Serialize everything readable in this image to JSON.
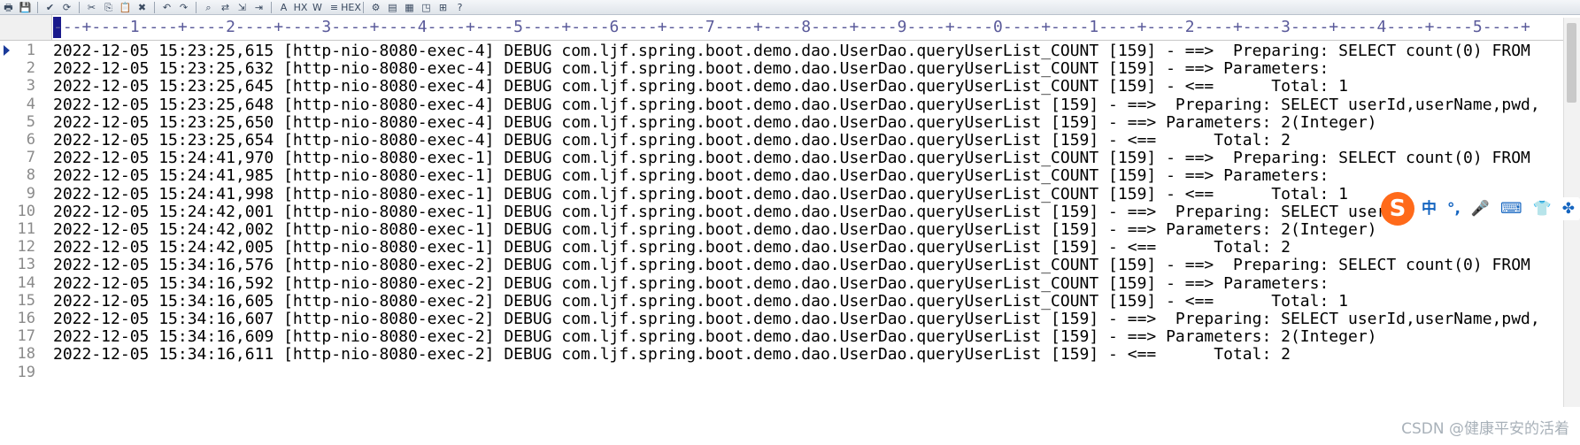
{
  "toolbar": {
    "icons": [
      "print-icon",
      "save-icon",
      "check-icon",
      "refresh-icon",
      "cut-icon",
      "copy-icon",
      "paste-icon",
      "delete-icon",
      "undo-icon",
      "redo-icon",
      "find-icon",
      "replace-icon",
      "goto-icon",
      "indent-icon",
      "font-icon",
      "hex-icon",
      "word-wrap-icon",
      "column-icon",
      "hex-edit-icon",
      "settings-icon",
      "window-icon",
      "tile-icon",
      "cascade-icon",
      "new-window-icon",
      "help-icon"
    ],
    "glyphs": [
      "🖶",
      "💾",
      "✔",
      "⟳",
      "✂",
      "⎘",
      "📋",
      "✖",
      "↶",
      "↷",
      "⌕",
      "⇄",
      "⇲",
      "⇥",
      "A",
      "HX",
      "W",
      "≡",
      "HEX",
      "⚙",
      "▤",
      "▦",
      "◳",
      "⊞",
      "?"
    ]
  },
  "ruler": {
    "text": "---+----1----+----2----+----3----+----4----+----5----+----6----+----7----+----8----+----9----+----0----+----1----+----2----+----3----+----4----+----5----+"
  },
  "editor": {
    "current_line": 1,
    "lines": [
      {
        "n": "1",
        "text": "2022-12-05 15:23:25,615 [http-nio-8080-exec-4] DEBUG com.ljf.spring.boot.demo.dao.UserDao.queryUserList_COUNT [159] - ==>  Preparing: SELECT count(0) FROM"
      },
      {
        "n": "2",
        "text": "2022-12-05 15:23:25,632 [http-nio-8080-exec-4] DEBUG com.ljf.spring.boot.demo.dao.UserDao.queryUserList_COUNT [159] - ==> Parameters: "
      },
      {
        "n": "3",
        "text": "2022-12-05 15:23:25,645 [http-nio-8080-exec-4] DEBUG com.ljf.spring.boot.demo.dao.UserDao.queryUserList_COUNT [159] - <==      Total: 1"
      },
      {
        "n": "4",
        "text": "2022-12-05 15:23:25,648 [http-nio-8080-exec-4] DEBUG com.ljf.spring.boot.demo.dao.UserDao.queryUserList [159] - ==>  Preparing: SELECT userId,userName,pwd,"
      },
      {
        "n": "5",
        "text": "2022-12-05 15:23:25,650 [http-nio-8080-exec-4] DEBUG com.ljf.spring.boot.demo.dao.UserDao.queryUserList [159] - ==> Parameters: 2(Integer)"
      },
      {
        "n": "6",
        "text": "2022-12-05 15:23:25,654 [http-nio-8080-exec-4] DEBUG com.ljf.spring.boot.demo.dao.UserDao.queryUserList [159] - <==      Total: 2"
      },
      {
        "n": "7",
        "text": "2022-12-05 15:24:41,970 [http-nio-8080-exec-1] DEBUG com.ljf.spring.boot.demo.dao.UserDao.queryUserList_COUNT [159] - ==>  Preparing: SELECT count(0) FROM"
      },
      {
        "n": "8",
        "text": "2022-12-05 15:24:41,985 [http-nio-8080-exec-1] DEBUG com.ljf.spring.boot.demo.dao.UserDao.queryUserList_COUNT [159] - ==> Parameters: "
      },
      {
        "n": "9",
        "text": "2022-12-05 15:24:41,998 [http-nio-8080-exec-1] DEBUG com.ljf.spring.boot.demo.dao.UserDao.queryUserList_COUNT [159] - <==      Total: 1"
      },
      {
        "n": "10",
        "text": "2022-12-05 15:24:42,001 [http-nio-8080-exec-1] DEBUG com.ljf.spring.boot.demo.dao.UserDao.queryUserList [159] - ==>  Preparing: SELECT userId,userName,pwd,"
      },
      {
        "n": "11",
        "text": "2022-12-05 15:24:42,002 [http-nio-8080-exec-1] DEBUG com.ljf.spring.boot.demo.dao.UserDao.queryUserList [159] - ==> Parameters: 2(Integer)"
      },
      {
        "n": "12",
        "text": "2022-12-05 15:24:42,005 [http-nio-8080-exec-1] DEBUG com.ljf.spring.boot.demo.dao.UserDao.queryUserList [159] - <==      Total: 2"
      },
      {
        "n": "13",
        "text": "2022-12-05 15:34:16,576 [http-nio-8080-exec-2] DEBUG com.ljf.spring.boot.demo.dao.UserDao.queryUserList_COUNT [159] - ==>  Preparing: SELECT count(0) FROM"
      },
      {
        "n": "14",
        "text": "2022-12-05 15:34:16,592 [http-nio-8080-exec-2] DEBUG com.ljf.spring.boot.demo.dao.UserDao.queryUserList_COUNT [159] - ==> Parameters: "
      },
      {
        "n": "15",
        "text": "2022-12-05 15:34:16,605 [http-nio-8080-exec-2] DEBUG com.ljf.spring.boot.demo.dao.UserDao.queryUserList_COUNT [159] - <==      Total: 1"
      },
      {
        "n": "16",
        "text": "2022-12-05 15:34:16,607 [http-nio-8080-exec-2] DEBUG com.ljf.spring.boot.demo.dao.UserDao.queryUserList [159] - ==>  Preparing: SELECT userId,userName,pwd,"
      },
      {
        "n": "17",
        "text": "2022-12-05 15:34:16,609 [http-nio-8080-exec-2] DEBUG com.ljf.spring.boot.demo.dao.UserDao.queryUserList [159] - ==> Parameters: 2(Integer)"
      },
      {
        "n": "18",
        "text": "2022-12-05 15:34:16,611 [http-nio-8080-exec-2] DEBUG com.ljf.spring.boot.demo.dao.UserDao.queryUserList [159] - <==      Total: 2"
      },
      {
        "n": "19",
        "text": ""
      }
    ]
  },
  "ime": {
    "logo": "S",
    "items": [
      {
        "icon": "chinese-mode-icon",
        "glyph": "中"
      },
      {
        "icon": "punctuation-icon",
        "glyph": "°,"
      },
      {
        "icon": "microphone-icon",
        "glyph": "🎤"
      },
      {
        "icon": "keyboard-icon",
        "glyph": "⌨"
      },
      {
        "icon": "skin-icon",
        "glyph": "👕"
      },
      {
        "icon": "toolbox-icon",
        "glyph": "✤"
      }
    ]
  },
  "watermark": "CSDN @健康平安的活着",
  "colors": {
    "line_number": "#8a8a8a",
    "text": "#000000",
    "ruler": "#5a5a9a",
    "ime_accent": "#ff6a1a",
    "ime_icons": "#1565c0"
  }
}
